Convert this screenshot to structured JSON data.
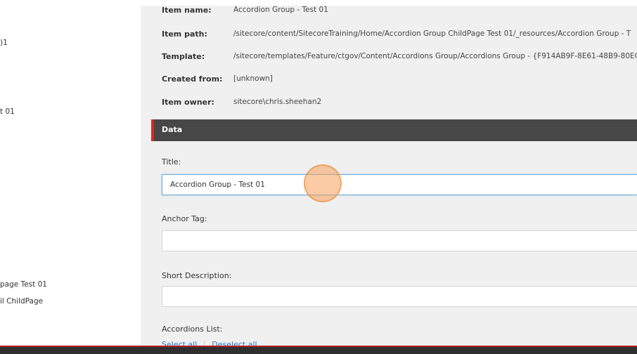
{
  "tree": {
    "items": [
      {
        "label": ")1"
      },
      {
        "label": "t 01"
      },
      {
        "label": "page Test 01"
      },
      {
        "label": "il ChildPage"
      }
    ]
  },
  "item_info": {
    "rows": [
      {
        "label": "Item name:",
        "value": "Accordion Group - Test 01"
      },
      {
        "label": "Item path:",
        "value": "/sitecore/content/SitecoreTraining/Home/Accordion Group ChildPage Test 01/_resources/Accordion Group - T"
      },
      {
        "label": "Template:",
        "value": "/sitecore/templates/Feature/ctgov/Content/Accordions Group/Accordions Group - {F914AB9F-8E61-48B9-80EC"
      },
      {
        "label": "Created from:",
        "value": "[unknown]"
      },
      {
        "label": "Item owner:",
        "value": "sitecore\\chris.sheehan2"
      }
    ]
  },
  "data_section": {
    "title": "Data"
  },
  "fields": {
    "title": {
      "label": "Title:",
      "value": "Accordion Group - Test 01"
    },
    "anchor_tag": {
      "label": "Anchor Tag:",
      "value": ""
    },
    "short_description": {
      "label": "Short Description:",
      "value": ""
    },
    "accordions_list": {
      "label": "Accordions List:"
    }
  },
  "list_actions": {
    "select_all": "Select all",
    "deselect_all": "Deselect all"
  },
  "colors": {
    "section_bar": "#474747",
    "section_accent": "#d12a2a",
    "link": "#2b78c4",
    "click_indicator": "#f5a05a"
  }
}
